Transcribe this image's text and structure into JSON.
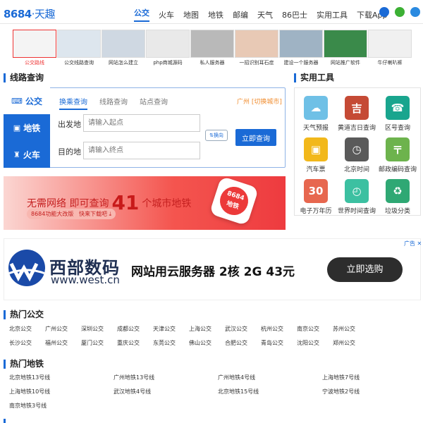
{
  "header": {
    "logo_num": "8684",
    "logo_sub": "·天趣",
    "nav": [
      "公交",
      "火车",
      "地图",
      "地铁",
      "邮编",
      "天气",
      "86巴士",
      "实用工具",
      "下载App"
    ],
    "nav_active": 0
  },
  "thumbs": [
    {
      "label": "公交路线",
      "selected": true
    },
    {
      "label": "公交线路查询",
      "selected": false
    },
    {
      "label": "网站怎么建立",
      "selected": false
    },
    {
      "label": "php商城源码",
      "selected": false
    },
    {
      "label": "私人服务器",
      "selected": false
    },
    {
      "label": "一招识别耳石症",
      "selected": false
    },
    {
      "label": "建设一个服务器",
      "selected": false
    },
    {
      "label": "网站推广软件",
      "selected": false
    },
    {
      "label": "牛仔喇叭裤",
      "selected": false
    }
  ],
  "route_query": {
    "title": "线路查询",
    "tabs": [
      "公交",
      "地铁",
      "火车"
    ],
    "sub_tabs": [
      "换乘查询",
      "线路查询",
      "站点查询"
    ],
    "city_text": "广州 [切换城市]",
    "from_label": "出发地",
    "from_placeholder": "请输入起点",
    "to_label": "目的地",
    "to_placeholder": "请输入终点",
    "swap_label": "⇅换向",
    "submit_label": "立即查询"
  },
  "banner": {
    "text_before": "无需网络 即可查询",
    "number": "41",
    "text_after": "个城市地铁",
    "pill_text": "8684功能大改版",
    "pill_link": "快来下载吧",
    "app_text": "8684\n地铁"
  },
  "tools": {
    "title": "实用工具",
    "items": [
      {
        "label": "天气预报",
        "color": "#6fc0e6",
        "glyph": "☁"
      },
      {
        "label": "黄道吉日查询",
        "color": "#c54a35",
        "glyph": "吉"
      },
      {
        "label": "区号查询",
        "color": "#19a58e",
        "glyph": "☎"
      },
      {
        "label": "汽车票",
        "color": "#f2b81b",
        "glyph": "▣"
      },
      {
        "label": "北京时间",
        "color": "#5a5a5a",
        "glyph": "◷"
      },
      {
        "label": "邮政编码查询",
        "color": "#6db34d",
        "glyph": "〒"
      },
      {
        "label": "电子万年历",
        "color": "#e7674f",
        "glyph": "30"
      },
      {
        "label": "世界时间查询",
        "color": "#3cc0a1",
        "glyph": "◴"
      },
      {
        "label": "垃圾分类",
        "color": "#2fa874",
        "glyph": "♻"
      }
    ]
  },
  "ad": {
    "tag": "广告",
    "brand": "西部数码",
    "url": "www.west.cn",
    "slogan": "网站用云服务器 2核 2G 43元",
    "button": "立即选购",
    "brand_color": "#1a4aa8"
  },
  "hot_bus": {
    "title": "热门公交",
    "cities": [
      "北京公交",
      "广州公交",
      "深圳公交",
      "成都公交",
      "天津公交",
      "上海公交",
      "武汉公交",
      "杭州公交",
      "南京公交",
      "苏州公交",
      "长沙公交",
      "福州公交",
      "厦门公交",
      "重庆公交",
      "东莞公交",
      "佛山公交",
      "合肥公交",
      "青岛公交",
      "沈阳公交",
      "郑州公交"
    ]
  },
  "hot_metro": {
    "title": "热门地铁",
    "lines": [
      "北京地铁13号线",
      "广州地铁13号线",
      "广州地铁4号线",
      "上海地铁7号线",
      "上海地铁10号线",
      "武汉地铁4号线",
      "北京地铁15号线",
      "宁波地铁2号线",
      "南京地铁3号线"
    ]
  }
}
